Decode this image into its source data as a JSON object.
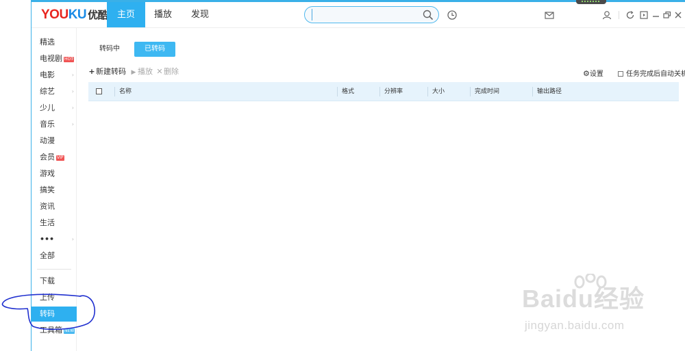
{
  "app": {
    "logo_brand": "YOUKU",
    "logo_cn": "优酷"
  },
  "nav": {
    "tabs": [
      {
        "label": "主页",
        "active": true
      },
      {
        "label": "播放",
        "active": false
      },
      {
        "label": "发现",
        "active": false
      }
    ]
  },
  "search": {
    "value": "",
    "placeholder": ""
  },
  "header_icons": [
    "history-icon",
    "message-icon",
    "user-icon",
    "refresh-icon",
    "minimize-to-tray-icon",
    "minimize-icon",
    "restore-icon",
    "close-icon"
  ],
  "sidebar": {
    "items": [
      {
        "label": "精选",
        "badge": "",
        "arrow": false
      },
      {
        "label": "电视剧",
        "badge": "HOT",
        "arrow": true
      },
      {
        "label": "电影",
        "badge": "",
        "arrow": true
      },
      {
        "label": "综艺",
        "badge": "",
        "arrow": true
      },
      {
        "label": "少儿",
        "badge": "",
        "arrow": true
      },
      {
        "label": "音乐",
        "badge": "",
        "arrow": true
      },
      {
        "label": "动漫",
        "badge": "",
        "arrow": false
      },
      {
        "label": "会员",
        "badge": "VIP",
        "arrow": false
      },
      {
        "label": "游戏",
        "badge": "",
        "arrow": false
      },
      {
        "label": "搞笑",
        "badge": "",
        "arrow": false
      },
      {
        "label": "资讯",
        "badge": "",
        "arrow": false
      },
      {
        "label": "生活",
        "badge": "",
        "arrow": false
      },
      {
        "label": "•••",
        "badge": "",
        "arrow": true
      },
      {
        "label": "全部",
        "badge": "",
        "arrow": false
      }
    ],
    "tools": [
      {
        "label": "下载",
        "badge": "",
        "active": false
      },
      {
        "label": "上传",
        "badge": "",
        "active": false
      },
      {
        "label": "转码",
        "badge": "",
        "active": true
      },
      {
        "label": "工具箱",
        "badge": "NEW",
        "active": false
      }
    ]
  },
  "transcode": {
    "subtabs": [
      {
        "label": "转码中",
        "active": false
      },
      {
        "label": "已转码",
        "active": true
      }
    ],
    "toolbar": {
      "new_label": "新建转码",
      "play_label": "播放",
      "delete_label": "删除",
      "settings_label": "设置",
      "shutdown_label": "任务完成后自动关机"
    },
    "columns": [
      "名称",
      "格式",
      "分辨率",
      "大小",
      "完成时间",
      "输出路径"
    ],
    "rows": []
  },
  "watermark": {
    "brand": "Baidu经验",
    "url": "jingyan.baidu.com"
  },
  "colors": {
    "accent": "#2eb0f0",
    "frame_border": "#3ab0e8",
    "badge_hot": "#f05454",
    "table_header_bg": "#e6f3fc",
    "annotation_stroke": "#1f2fcf"
  }
}
